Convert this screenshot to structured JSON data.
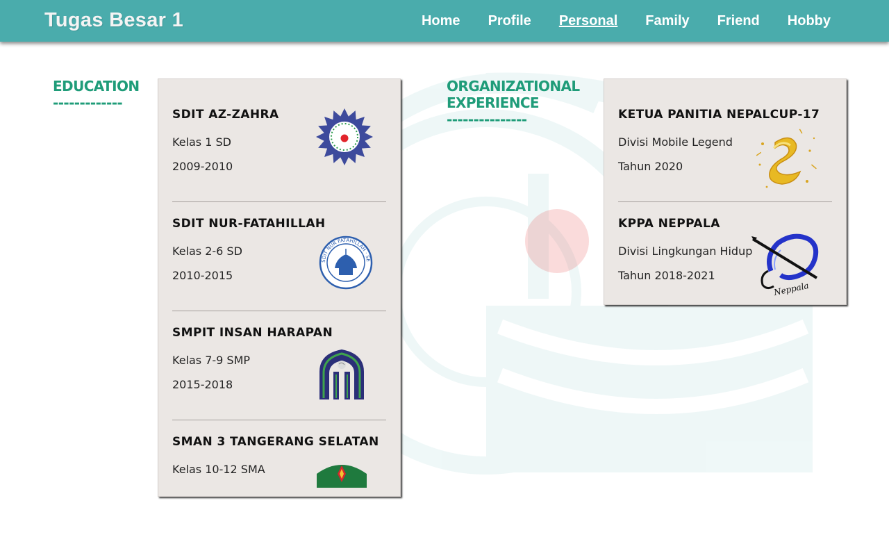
{
  "header": {
    "title": "Tugas Besar 1",
    "nav": [
      {
        "label": "Home"
      },
      {
        "label": "Profile"
      },
      {
        "label": "Personal",
        "active": true
      },
      {
        "label": "Family"
      },
      {
        "label": "Friend"
      },
      {
        "label": "Hobby"
      }
    ]
  },
  "education": {
    "title": "EDUCATION",
    "underline": "-------------",
    "items": [
      {
        "name": "SDIT AZ-ZAHRA",
        "detail": "Kelas 1 SD",
        "years": "2009-2010",
        "logo": "az-zahra-logo-icon"
      },
      {
        "name": "SDIT NUR-FATAHILLAH",
        "detail": "Kelas 2-6 SD",
        "years": "2010-2015",
        "logo": "nur-fatahillah-logo-icon",
        "logo_text": "SDIT NUR FATAHILLAH · SERPONG TANGSEL"
      },
      {
        "name": "SMPIT INSAN HARAPAN",
        "detail": "Kelas 7-9 SMP",
        "years": "2015-2018",
        "logo": "insan-harapan-logo-icon"
      },
      {
        "name": "SMAN 3 TANGERANG SELATAN",
        "detail": "Kelas 10-12 SMA",
        "years": "",
        "logo": "sman3-logo-icon"
      }
    ]
  },
  "organization": {
    "title_line1": "ORGANIZATIONAL",
    "title_line2": "EXPERIENCE",
    "underline": "---------------",
    "items": [
      {
        "name": "KETUA PANITIA NEPALCUP-17",
        "detail": "Divisi Mobile Legend",
        "years": "Tahun 2020",
        "logo": "nepalcup-logo-icon"
      },
      {
        "name": "KPPA NEPPALA",
        "detail": "Divisi Lingkungan Hidup",
        "years": "Tahun 2018-2021",
        "logo": "neppala-logo-icon",
        "logo_text": "Neppala"
      }
    ]
  },
  "colors": {
    "navbar": "#4aacac",
    "accent": "#1f9c79",
    "card": "#ebe7e4"
  }
}
